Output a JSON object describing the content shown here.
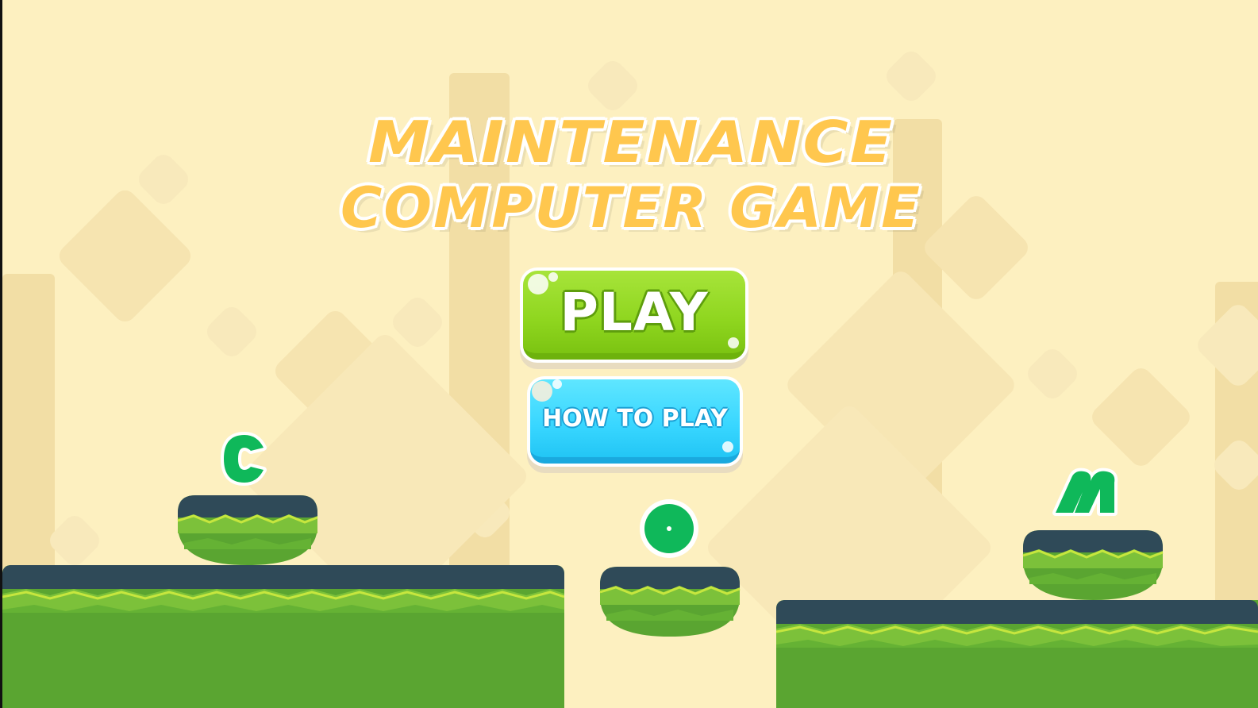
{
  "game": {
    "title_line1": "MAINTENANCE",
    "title_line2": "COMPUTER GAME",
    "buttons": {
      "play": "PLAY",
      "how_to_play": "HOW TO PLAY"
    },
    "tokens": [
      "C",
      "O",
      "M"
    ]
  },
  "colors": {
    "background": "#fdf0c0",
    "title_fill": "#ffc74e",
    "play_button": "#8fd61f",
    "how_button": "#38d6ff",
    "grass": "#5aa531",
    "platform_cap": "#2f4a58",
    "token_green": "#0fb85a"
  },
  "icons": [
    "c-letter-token",
    "o-letter-token",
    "m-letter-token"
  ]
}
